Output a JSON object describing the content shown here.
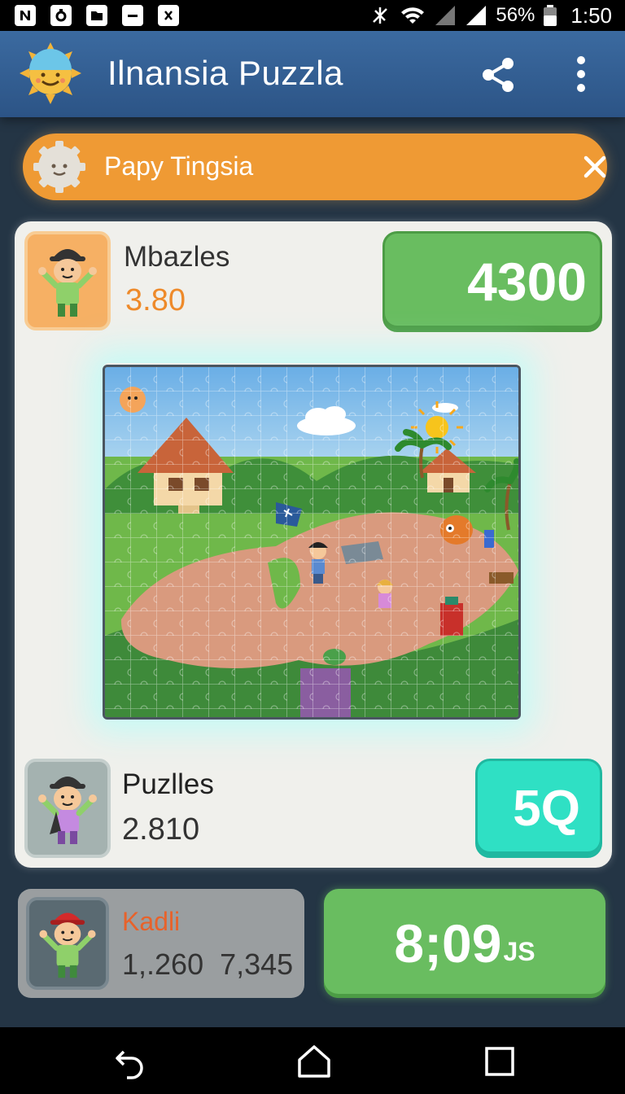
{
  "status_bar": {
    "battery": "56%",
    "time": "1:50",
    "icons": [
      "n-icon",
      "camera-icon",
      "folder-icon",
      "minus-icon",
      "x-icon",
      "no-signal-icon",
      "wifi-icon",
      "signal-icon",
      "signal-icon",
      "battery-icon"
    ]
  },
  "app_bar": {
    "title": "Ilnansia  Puzzla",
    "icons": [
      "sun-logo-icon",
      "share-icon",
      "more-vertical-icon"
    ]
  },
  "banner": {
    "text": "Papy Tingsia",
    "icons": [
      "gear-face-icon",
      "close-icon"
    ]
  },
  "players": [
    {
      "name": "Mbazles",
      "score": "3.80",
      "badge": "4300",
      "badge_color": "#69bd60"
    },
    {
      "name": "Puzlles",
      "score": "2.810",
      "badge": "5Q",
      "badge_color": "#2fe0c4"
    }
  ],
  "leader": {
    "name": "Kadli",
    "scores": "1,.260  7,345"
  },
  "timer": {
    "value": "8;09",
    "unit": "JS"
  },
  "nav": {
    "icons": [
      "back-icon",
      "home-icon",
      "recents-icon"
    ]
  },
  "colors": {
    "app_bar": "#3b6aa0",
    "banner": "#ef9a34",
    "accent_orange": "#ee8a2a",
    "green_button": "#69bd60",
    "teal_button": "#2fe0c4"
  }
}
